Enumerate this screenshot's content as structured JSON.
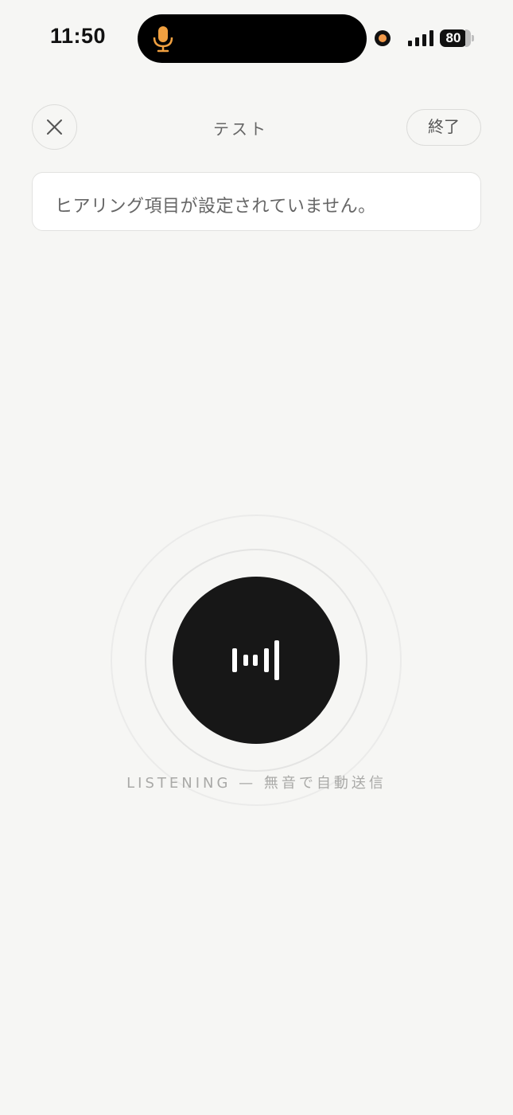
{
  "status_bar": {
    "time": "11:50",
    "battery": "80",
    "icons": [
      "microphone-icon",
      "recording-dot-icon",
      "signal-icon",
      "battery-icon"
    ],
    "mic_color": "#f0a040",
    "rec_color": "#f29a4a"
  },
  "header": {
    "title": "テスト",
    "end_label": "終了",
    "close_icon": "close-icon"
  },
  "message": {
    "text": "ヒアリング項目が設定されていません。"
  },
  "mic": {
    "icon": "waveform-icon",
    "status_label": "LISTENING — 無音で自動送信"
  }
}
